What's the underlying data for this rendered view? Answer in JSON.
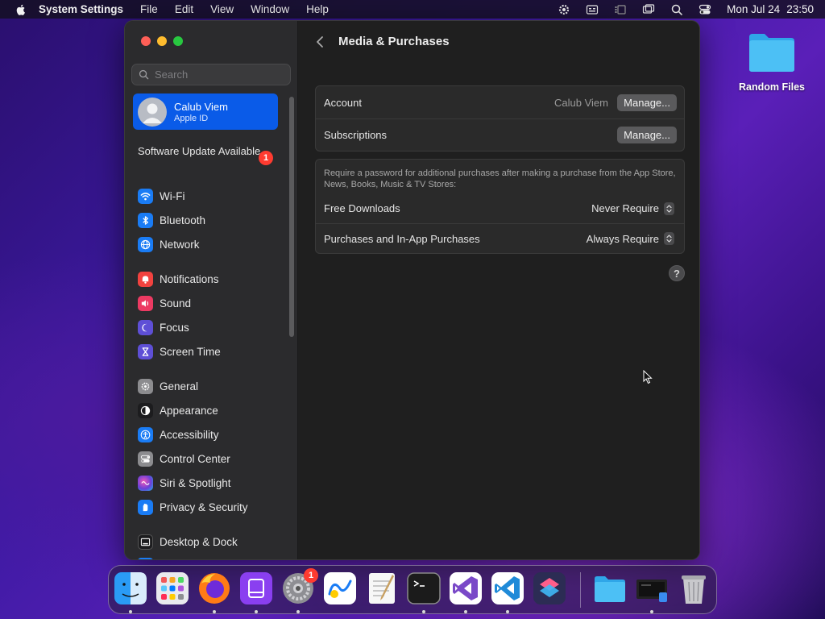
{
  "menubar": {
    "app_name": "System Settings",
    "menus": [
      "File",
      "Edit",
      "View",
      "Window",
      "Help"
    ],
    "date": "Mon Jul 24",
    "time": "23:50"
  },
  "desktop": {
    "folder_label": "Random Files"
  },
  "sidebar": {
    "search_placeholder": "Search",
    "account": {
      "name": "Calub Viem",
      "subtitle": "Apple ID"
    },
    "update": {
      "label": "Software Update Available",
      "badge": "1"
    },
    "groups": [
      [
        {
          "label": "Wi-Fi",
          "icon": "wifi-icon",
          "color": "#1a7cf5"
        },
        {
          "label": "Bluetooth",
          "icon": "bluetooth-icon",
          "color": "#1a7cf5"
        },
        {
          "label": "Network",
          "icon": "globe-icon",
          "color": "#1a7cf5"
        }
      ],
      [
        {
          "label": "Notifications",
          "icon": "bell-icon",
          "color": "#f2423f"
        },
        {
          "label": "Sound",
          "icon": "speaker-icon",
          "color": "#ec3a62"
        },
        {
          "label": "Focus",
          "icon": "moon-icon",
          "color": "#5e4fd6"
        },
        {
          "label": "Screen Time",
          "icon": "hourglass-icon",
          "color": "#5e4fd6"
        }
      ],
      [
        {
          "label": "General",
          "icon": "gear-icon",
          "color": "#8c8c8f"
        },
        {
          "label": "Appearance",
          "icon": "appearance-icon",
          "color": "#1c1c1e"
        },
        {
          "label": "Accessibility",
          "icon": "accessibility-icon",
          "color": "#1a7cf5"
        },
        {
          "label": "Control Center",
          "icon": "toggles-icon",
          "color": "#8c8c8f"
        },
        {
          "label": "Siri & Spotlight",
          "icon": "siri-icon",
          "color": "#6b3fd8"
        },
        {
          "label": "Privacy & Security",
          "icon": "hand-icon",
          "color": "#1a7cf5"
        }
      ],
      [
        {
          "label": "Desktop & Dock",
          "icon": "dock-icon",
          "color": "#1c1c1e"
        }
      ]
    ]
  },
  "content": {
    "title": "Media & Purchases",
    "account_row": {
      "label": "Account",
      "value": "Calub Viem",
      "button": "Manage..."
    },
    "subscriptions_row": {
      "label": "Subscriptions",
      "button": "Manage..."
    },
    "note": "Require a password for additional purchases after making a purchase from the App Store, News, Books, Music & TV Stores:",
    "free_downloads": {
      "label": "Free Downloads",
      "value": "Never Require"
    },
    "purchases": {
      "label": "Purchases and In-App Purchases",
      "value": "Always Require"
    },
    "help": "?"
  },
  "dock": {
    "items": [
      "finder-icon",
      "launchpad-icon",
      "firefox-icon",
      "podcasts-like-icon",
      "system-settings-icon",
      "freeform-icon",
      "textedit-icon",
      "terminal-icon",
      "visual-studio-icon",
      "vscode-icon",
      "shortcuts-icon",
      "folder-icon",
      "screen-recorder-icon",
      "trash-icon"
    ],
    "settings_badge": "1"
  }
}
